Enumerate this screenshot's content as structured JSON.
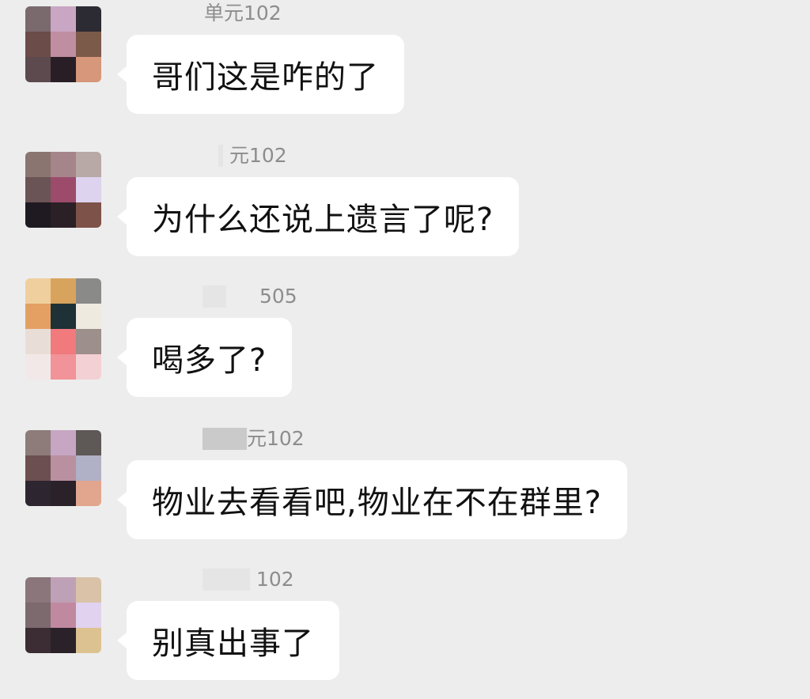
{
  "messages": [
    {
      "sender": "单元102",
      "text": "哥们这是咋的了",
      "avatar_colors": [
        "#7a6a6e",
        "#c9a6c4",
        "#2c2a33",
        "#6c4c48",
        "#c08ea1",
        "#7c5a4a",
        "#5c4a4e",
        "#2a1e26",
        "#d6977a"
      ]
    },
    {
      "sender": "元102",
      "text": "为什么还说上遗言了呢?",
      "avatar_colors": [
        "#8a7570",
        "#a6858a",
        "#b9a9a6",
        "#6b5455",
        "#9c4b6b",
        "#ddd3ef",
        "#1f1a22",
        "#2a2026",
        "#7d5248"
      ]
    },
    {
      "sender": "505",
      "text": "喝多了?",
      "avatar_colors": [
        "#efcf9e",
        "#d8a45d",
        "#8a8a88",
        "#e4a063",
        "#1d3137",
        "#eeeae0",
        "#e9ded7",
        "#f07a7c",
        "#9d8f8b",
        "#f3e8e8",
        "#f19398",
        "#f3d0d3"
      ]
    },
    {
      "sender": "元102",
      "text": "物业去看看吧,物业在不在群里?",
      "avatar_colors": [
        "#8d7c7a",
        "#c6a6c3",
        "#5e5856",
        "#6c4f50",
        "#b9909f",
        "#b0b0c6",
        "#2d2530",
        "#2a2129",
        "#e2a58e"
      ]
    },
    {
      "sender": "102",
      "text": "别真出事了",
      "avatar_colors": [
        "#8a767b",
        "#bfa1b7",
        "#d9c2a8",
        "#7c6a6f",
        "#c1899f",
        "#e1d2ef",
        "#3b2d33",
        "#2a2228",
        "#ddc291"
      ]
    }
  ]
}
